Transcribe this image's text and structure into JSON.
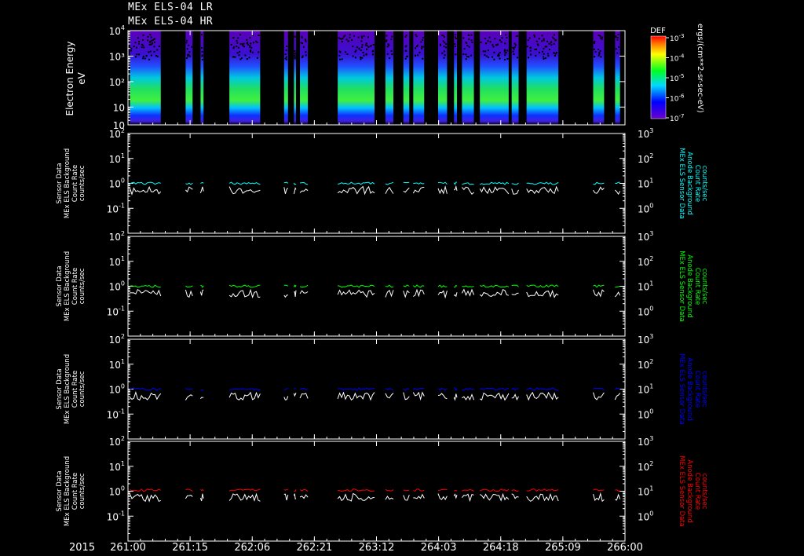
{
  "title_lines": [
    "MEx ELS-04 LR",
    "MEx ELS-04 HR"
  ],
  "spectrogram": {
    "ylabel": "Electron Energy",
    "yunit": "eV",
    "yticks": [
      "10",
      "10³",
      "10²",
      "10",
      "10"
    ],
    "ytick_sups": [
      "4",
      "",
      "",
      "",
      ""
    ],
    "colorbar": {
      "label": "DEF",
      "unit": "ergs/(cm**2-sr-sec-eV)",
      "tick_bases": [
        "10",
        "10",
        "10",
        "10",
        "10"
      ],
      "tick_exps": [
        "-3",
        "-4",
        "-5",
        "-6",
        "-7"
      ]
    }
  },
  "colors": {
    "background": "#000000",
    "axes": "#ffffff",
    "panel1_series": "#00ffff",
    "panel2_series": "#00ff00",
    "panel3_series": "#0000ff",
    "panel4_series": "#ff0000",
    "background_series": "#ffffff"
  },
  "panels": [
    {
      "left_label": [
        "Sensor Data",
        "MEx ELS Background",
        "Count Rate",
        "counts/sec"
      ],
      "right_label": [
        "MEx ELS Sensor Data",
        "Anode Background",
        "Count Rate",
        "counts/sec"
      ],
      "color_key": "panel1_series"
    },
    {
      "left_label": [
        "Sensor Data",
        "MEx ELS Background",
        "Count Rate",
        "counts/sec"
      ],
      "right_label": [
        "MEx ELS Sensor Data",
        "Anode Background",
        "Count Rate",
        "counts/sec"
      ],
      "color_key": "panel2_series"
    },
    {
      "left_label": [
        "Sensor Data",
        "MEx ELS Background",
        "Count Rate",
        "counts/sec"
      ],
      "right_label": [
        "MEx ELS Sensor Data",
        "Anode Background",
        "Count Rate",
        "counts/sec"
      ],
      "color_key": "panel3_series"
    },
    {
      "left_label": [
        "Sensor Data",
        "MEx ELS Background",
        "Count Rate",
        "counts/sec"
      ],
      "right_label": [
        "MEx ELS Sensor Data",
        "Anode Background",
        "Count Rate",
        "counts/sec"
      ],
      "color_key": "panel4_series"
    }
  ],
  "left_axis_ticks": {
    "bases": [
      "10",
      "10",
      "10",
      "10"
    ],
    "exps": [
      "2",
      "1",
      "0",
      "-1"
    ]
  },
  "right_axis_ticks": {
    "bases": [
      "10",
      "10",
      "10",
      "10"
    ],
    "exps": [
      "3",
      "2",
      "1",
      "0"
    ]
  },
  "xaxis": {
    "year": "2015",
    "tick_labels": [
      "261:00",
      "261:15",
      "262:06",
      "262:21",
      "263:12",
      "264:03",
      "264:18",
      "265:09",
      "266:00"
    ]
  },
  "chart_data": {
    "type": "line",
    "title": "MEx ELS-04 LR / MEx ELS-04 HR",
    "x_range_doy": [
      261.0,
      266.0
    ],
    "x_ticks_doy": [
      261.0,
      261.625,
      262.25,
      262.875,
      263.5,
      264.125,
      264.75,
      265.375,
      266.0
    ],
    "data_intervals_doy": [
      [
        261.02,
        261.33
      ],
      [
        261.58,
        261.65
      ],
      [
        261.73,
        261.76
      ],
      [
        262.02,
        262.33
      ],
      [
        262.57,
        262.61
      ],
      [
        262.67,
        262.69
      ],
      [
        262.73,
        262.81
      ],
      [
        263.11,
        263.48
      ],
      [
        263.59,
        263.67
      ],
      [
        263.77,
        263.83
      ],
      [
        263.87,
        263.98
      ],
      [
        264.12,
        264.21
      ],
      [
        264.28,
        264.31
      ],
      [
        264.36,
        264.48
      ],
      [
        264.54,
        264.83
      ],
      [
        264.86,
        264.93
      ],
      [
        265.01,
        265.33
      ],
      [
        265.68,
        265.79
      ],
      [
        265.9,
        265.95
      ]
    ],
    "spectrogram": {
      "y_scale": "log",
      "ylim": [
        2,
        10000
      ],
      "z_scale": "log",
      "zlim": [
        1e-07,
        0.001
      ],
      "z_unit": "ergs/(cm**2-sr-sec-eV)"
    },
    "count_panels": {
      "y_scale": "log",
      "left_ylim": [
        0.01,
        100
      ],
      "right_ylim": [
        0.1,
        1000
      ]
    },
    "series": [
      {
        "panel": 1,
        "approx_value_counts_per_sec": 1.0,
        "color": "#00ffff"
      },
      {
        "panel": 1,
        "approx_value_counts_per_sec": 0.6,
        "color": "#ffffff"
      },
      {
        "panel": 2,
        "approx_value_counts_per_sec": 1.0,
        "color": "#00ff00"
      },
      {
        "panel": 2,
        "approx_value_counts_per_sec": 0.6,
        "color": "#ffffff"
      },
      {
        "panel": 3,
        "approx_value_counts_per_sec": 1.0,
        "color": "#0000ff"
      },
      {
        "panel": 3,
        "approx_value_counts_per_sec": 0.6,
        "color": "#ffffff"
      },
      {
        "panel": 4,
        "approx_value_counts_per_sec": 1.1,
        "color": "#ff0000"
      },
      {
        "panel": 4,
        "approx_value_counts_per_sec": 0.65,
        "color": "#ffffff"
      }
    ]
  }
}
